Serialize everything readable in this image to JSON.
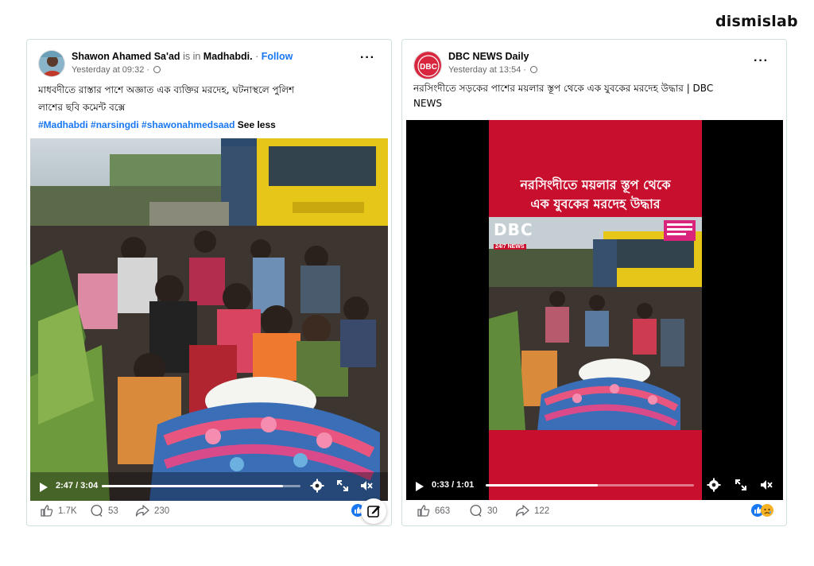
{
  "brand": {
    "name": "dismislab"
  },
  "posts": [
    {
      "author": "Shawon Ahamed Sa'ad",
      "is_in": "is in",
      "location": "Madhabdi.",
      "separator": "·",
      "follow_label": "Follow",
      "timestamp": "Yesterday at 09:32 ·",
      "caption_line1": "মাধবদীতে রাস্তার পাশে অজ্ঞাত এক ব্যক্তির মরদেহ, ঘটনাস্থলে পুলিশ",
      "caption_line2": "লাশের ছবি কমেন্ট বক্সে",
      "hashtags": [
        "#Madhabdi",
        "#narsingdi",
        "#shawonahmedsaad"
      ],
      "see_less": "See less",
      "video": {
        "time": "2:47 / 3:04",
        "progress": 0.91
      },
      "reactions": {
        "likes": "1.7K",
        "comments": "53",
        "shares": "230"
      },
      "reaction_icons": [
        "like-icon"
      ],
      "avatar_icon": "user-avatar-icon"
    },
    {
      "author": "DBC NEWS Daily",
      "timestamp": "Yesterday at 13:54 ·",
      "avatar_text": "DBC",
      "caption_line1": "নরসিংদীতে সড়কের পাশের ময়লার স্তূপ থেকে এক যুবকের মরদেহ উদ্ধার | DBC",
      "caption_line2": "NEWS",
      "video": {
        "time": "0:33 / 1:01",
        "progress": 0.54,
        "overlay_headline_line1": "নরসিংদীতে ময়লার স্তূপ থেকে",
        "overlay_headline_line2": "এক যুবকের মরদেহ উদ্ধার",
        "logo_main": "DBC",
        "logo_sub": "24/7 NEWS"
      },
      "reactions": {
        "likes": "663",
        "comments": "30",
        "shares": "122"
      },
      "reaction_icons": [
        "like-icon",
        "sad-icon"
      ]
    }
  ],
  "colors": {
    "link_blue": "#1877f2",
    "muted_text": "#65676b",
    "card_border": "#cfe3dc",
    "dbc_red": "#d7263d",
    "news_red": "#c8102e",
    "truck_yellow": "#e6c619"
  }
}
